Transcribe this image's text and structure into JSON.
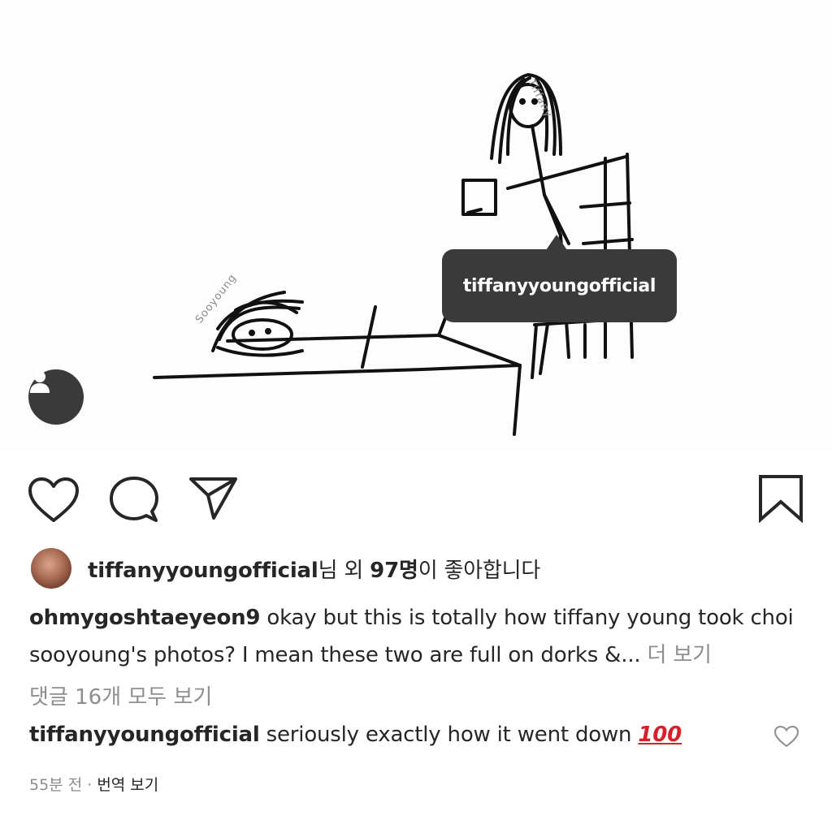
{
  "post": {
    "doodle_labels": {
      "tiffany": "Tiffany",
      "sooyoung": "Sooyoung"
    },
    "tag_tooltip": "tiffanyyoungofficial"
  },
  "actions": {
    "like_icon": "heart-outline-icon",
    "comment_icon": "comment-bubble-icon",
    "share_icon": "paper-plane-icon",
    "save_icon": "bookmark-outline-icon"
  },
  "likes": {
    "user": "tiffanyyoungofficial",
    "suffix_1": "님 외 ",
    "count": "97명",
    "suffix_2": "이 좋아합니다"
  },
  "caption": {
    "user": "ohmygoshtaeyeon9",
    "text": " okay but this is totally how tiffany young took choi sooyoung's photos? I mean these two are full on dorks &...",
    "more": " 더 보기"
  },
  "view_comments": "댓글 16개 모두 보기",
  "comment": {
    "user": "tiffanyyoungofficial",
    "text": " seriously exactly how it went down ",
    "emoji": "100"
  },
  "meta": {
    "time": "55분 전",
    "separator": " · ",
    "translate": "번역 보기"
  }
}
